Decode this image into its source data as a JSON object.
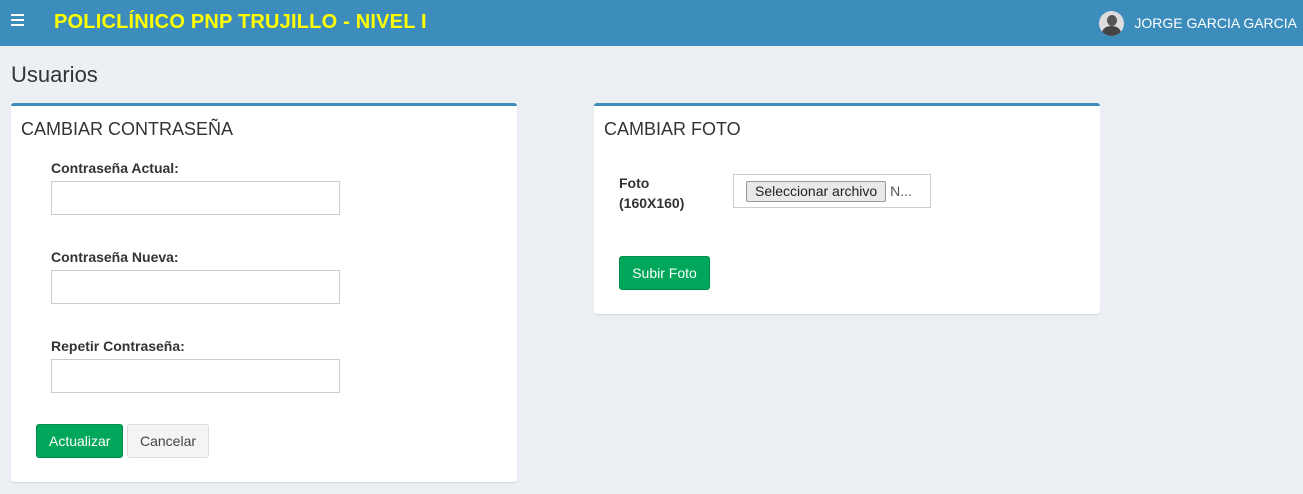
{
  "header": {
    "brand": "POLICLÍNICO PNP TRUJILLO - NIVEL I",
    "user_name": "JORGE GARCIA GARCIA"
  },
  "page": {
    "title": "Usuarios"
  },
  "change_password": {
    "title": "CAMBIAR CONTRASEÑA",
    "current_label": "Contraseña Actual:",
    "current_value": "",
    "new_label": "Contraseña Nueva:",
    "new_value": "",
    "repeat_label": "Repetir Contraseña:",
    "repeat_value": "",
    "update_label": "Actualizar",
    "cancel_label": "Cancelar"
  },
  "change_photo": {
    "title": "CAMBIAR FOTO",
    "photo_label": "Foto",
    "photo_size": "(160X160)",
    "file_button": "Seleccionar archivo",
    "file_status": "N...",
    "upload_label": "Subir Foto"
  },
  "colors": {
    "header_bg": "#3c8dbc",
    "brand_text": "#ffff00",
    "success": "#00a65a",
    "page_bg": "#ecf0f5"
  },
  "icons": {
    "menu": "hamburger-menu-icon",
    "avatar": "user-avatar-icon"
  }
}
